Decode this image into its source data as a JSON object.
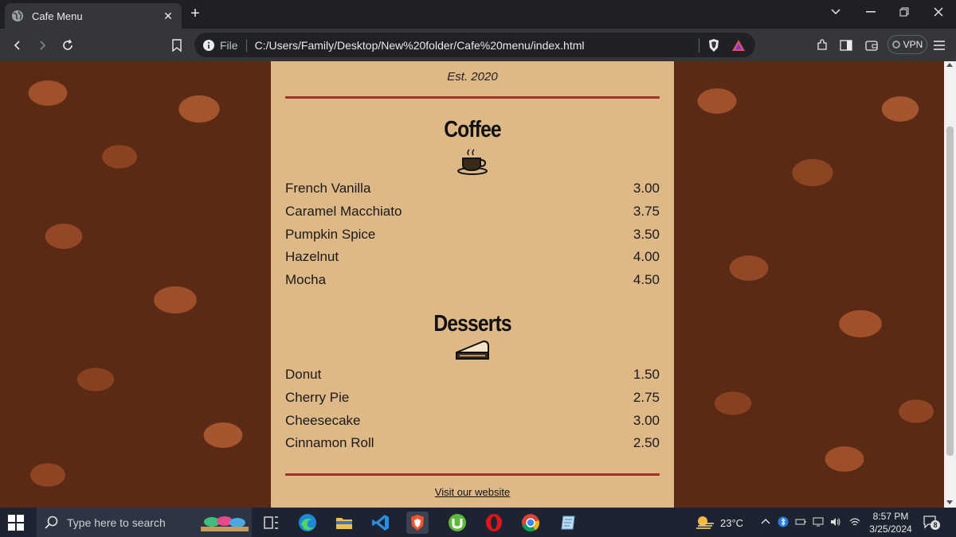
{
  "browser": {
    "tab_title": "Cafe Menu",
    "file_label": "File",
    "url": "C:/Users/Family/Desktop/New%20folder/Cafe%20menu/index.html",
    "vpn_label": "VPN"
  },
  "menu": {
    "established": "Est. 2020",
    "sections": [
      {
        "title": "Coffee",
        "icon": "coffee-cup-icon",
        "items": [
          {
            "name": "French Vanilla",
            "price": "3.00"
          },
          {
            "name": "Caramel Macchiato",
            "price": "3.75"
          },
          {
            "name": "Pumpkin Spice",
            "price": "3.50"
          },
          {
            "name": "Hazelnut",
            "price": "4.00"
          },
          {
            "name": "Mocha",
            "price": "4.50"
          }
        ]
      },
      {
        "title": "Desserts",
        "icon": "pie-slice-icon",
        "items": [
          {
            "name": "Donut",
            "price": "1.50"
          },
          {
            "name": "Cherry Pie",
            "price": "2.75"
          },
          {
            "name": "Cheesecake",
            "price": "3.00"
          },
          {
            "name": "Cinnamon Roll",
            "price": "2.50"
          }
        ]
      }
    ],
    "footer_link": "Visit our website"
  },
  "taskbar": {
    "search_placeholder": "Type here to search",
    "temperature": "23°C",
    "time": "8:57 PM",
    "date": "3/25/2024",
    "notification_count": "8"
  },
  "colors": {
    "menu_background": "#deb887",
    "divider": "#a0302a"
  }
}
